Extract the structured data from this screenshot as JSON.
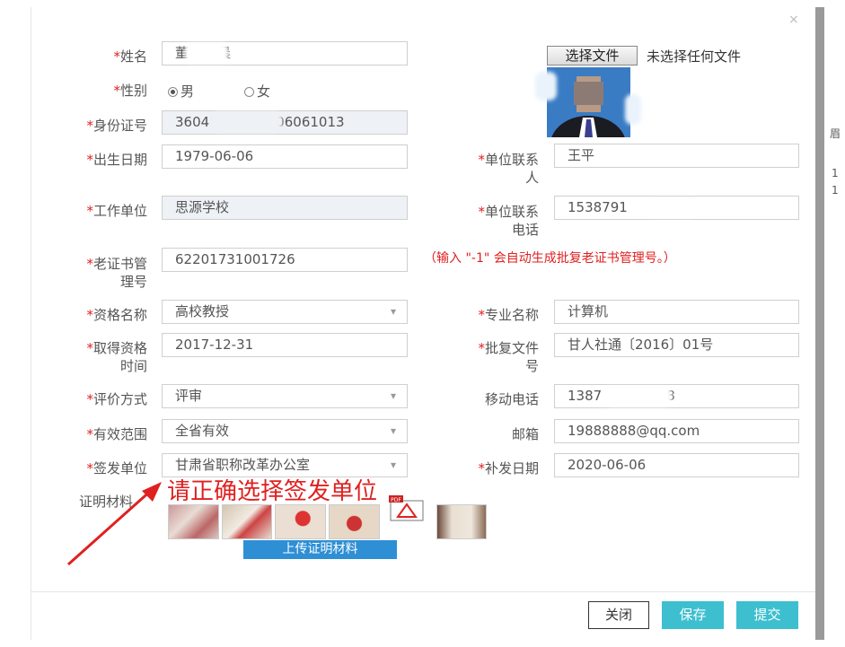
{
  "dialog": {
    "close_glyph": "×"
  },
  "form": {
    "name": {
      "label": "姓名",
      "value_prefix": "董",
      "value_suffix": "晨"
    },
    "gender": {
      "label": "性别",
      "options": [
        "男",
        "女"
      ],
      "selected": "男"
    },
    "id_number": {
      "label": "身份证号",
      "value_prefix": "3604",
      "value_suffix": "06061013"
    },
    "birth_date": {
      "label": "出生日期",
      "value": "1979-06-06"
    },
    "unit_contact": {
      "label_line1": "单位联系",
      "label_line2": "人",
      "value": "王平"
    },
    "work_unit": {
      "label": "工作单位",
      "value": "思源学校"
    },
    "unit_phone": {
      "label_line1": "单位联系",
      "label_line2": "电话",
      "value": "1538791"
    },
    "cert_number": {
      "label_line1": "老证书管",
      "label_line2": "理号",
      "value": "62201731001726"
    },
    "cert_hint": "（输入 \"-1\" 会自动生成批复老证书管理号。）",
    "qualification": {
      "label": "资格名称",
      "value": "高校教授",
      "icon": "chevron-down-icon"
    },
    "specialty": {
      "label": "专业名称",
      "value": "计算机"
    },
    "qual_date": {
      "label_line1": "取得资格",
      "label_line2": "时间",
      "value": "2017-12-31"
    },
    "approval_doc": {
      "label_line1": "批复文件",
      "label_line2": "号",
      "value": "甘人社通〔2016〕01号"
    },
    "eval_method": {
      "label": "评价方式",
      "value": "评审"
    },
    "mobile": {
      "label": "移动电话",
      "value_prefix": "1387",
      "value_suffix": "8"
    },
    "scope": {
      "label": "有效范围",
      "value": "全省有效"
    },
    "email": {
      "label": "邮箱",
      "value": "19888888@qq.com"
    },
    "issuer": {
      "label": "签发单位",
      "value": "甘肃省职称改革办公室"
    },
    "reissue_date": {
      "label": "补发日期",
      "value": "2020-06-06"
    },
    "materials": {
      "label": "证明材料",
      "upload_label": "上传证明材料",
      "pdf_tag": "PDF"
    }
  },
  "photo_upload": {
    "button_label": "选择文件",
    "status": "未选择任何文件"
  },
  "annotation": {
    "text": "请正确选择签发单位",
    "color": "#e02020"
  },
  "footer": {
    "close_label": "关闭",
    "save_label": "保存",
    "submit_label": "提交"
  },
  "colors": {
    "accent": "#3dbfd0",
    "upload": "#2f8fd4",
    "required": "#e02020"
  }
}
